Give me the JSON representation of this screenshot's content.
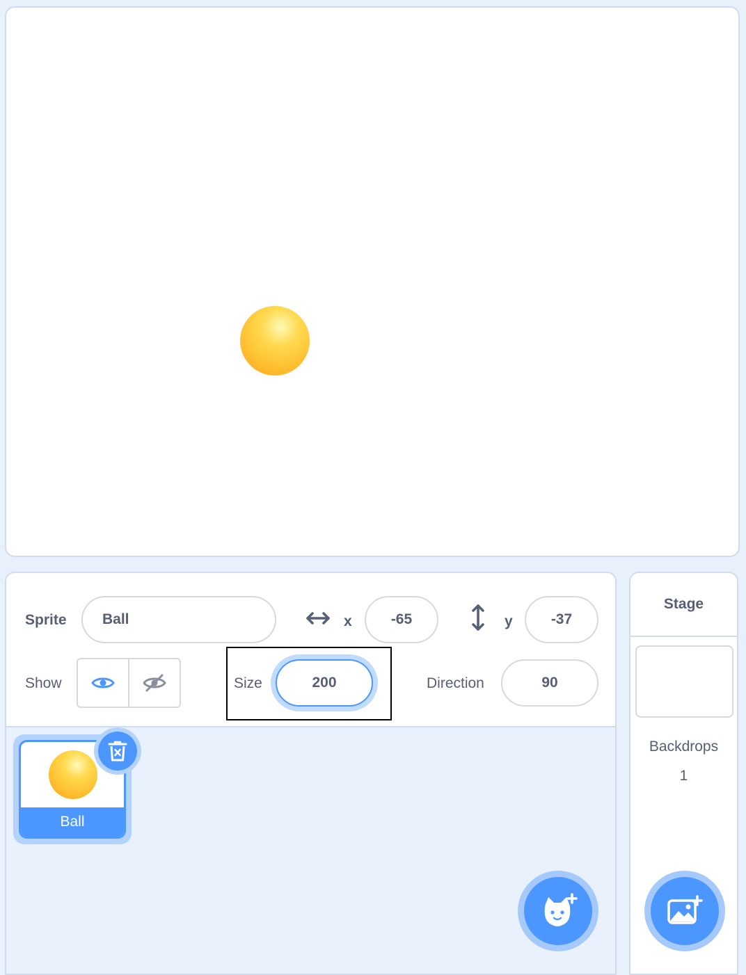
{
  "sprite_info": {
    "sprite_label": "Sprite",
    "sprite_name": "Ball",
    "x_label": "x",
    "x_value": "-65",
    "y_label": "y",
    "y_value": "-37",
    "show_label": "Show",
    "size_label": "Size",
    "size_value": "200",
    "direction_label": "Direction",
    "direction_value": "90"
  },
  "sprite_list": [
    {
      "name": "Ball",
      "selected": true
    }
  ],
  "stage_panel": {
    "title": "Stage",
    "backdrops_label": "Backdrops",
    "backdrops_count": "1"
  },
  "icons": {
    "x_arrow": "horizontal-arrow-icon",
    "y_arrow": "vertical-arrow-icon",
    "show": "eye-icon",
    "hide": "eye-slash-icon",
    "delete": "trash-icon",
    "add_sprite": "cat-plus-icon",
    "add_backdrop": "image-plus-icon"
  },
  "colors": {
    "accent": "#4c97ff",
    "text": "#575e75",
    "pane_bg": "#e9f1fc",
    "ball": "#ffbd2e"
  }
}
